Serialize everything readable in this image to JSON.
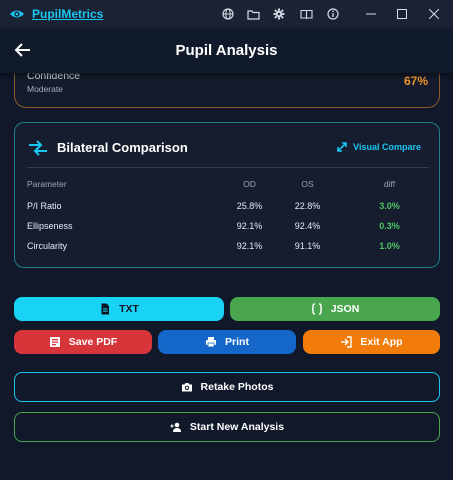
{
  "window": {
    "app_title": "PupilMetrics",
    "icons": [
      "eye-icon",
      "globe-icon",
      "folder-icon",
      "gear-icon",
      "book-icon",
      "info-icon",
      "minimize-icon",
      "maximize-icon",
      "close-icon"
    ]
  },
  "appbar": {
    "title": "Pupil Analysis",
    "back_icon": "arrow-left-icon"
  },
  "confidence": {
    "label": "Confidence",
    "level": "Moderate",
    "value": "67%"
  },
  "comparison": {
    "title": "Bilateral Comparison",
    "visual_compare_label": "Visual Compare",
    "headers": {
      "param": "Parameter",
      "od": "OD",
      "os": "OS",
      "diff": "diff"
    },
    "rows": [
      {
        "param": "P/I Ratio",
        "od": "25.8%",
        "os": "22.8%",
        "diff": "3.0%"
      },
      {
        "param": "Ellipseness",
        "od": "92.1%",
        "os": "92.4%",
        "diff": "0.3%"
      },
      {
        "param": "Circularity",
        "od": "92.1%",
        "os": "91.1%",
        "diff": "1.0%"
      }
    ]
  },
  "actions": {
    "txt": "TXT",
    "json": "JSON",
    "save_pdf": "Save PDF",
    "print": "Print",
    "exit_app": "Exit App",
    "retake": "Retake Photos",
    "new_analysis": "Start New Analysis"
  },
  "colors": {
    "accent": "#19c6f0",
    "confidence": "#f0932a",
    "diff": "#4cc564",
    "json_btn": "#4aa64e",
    "pdf_btn": "#d6363a",
    "print_btn": "#1467c8",
    "exit_btn": "#f27c0a"
  }
}
